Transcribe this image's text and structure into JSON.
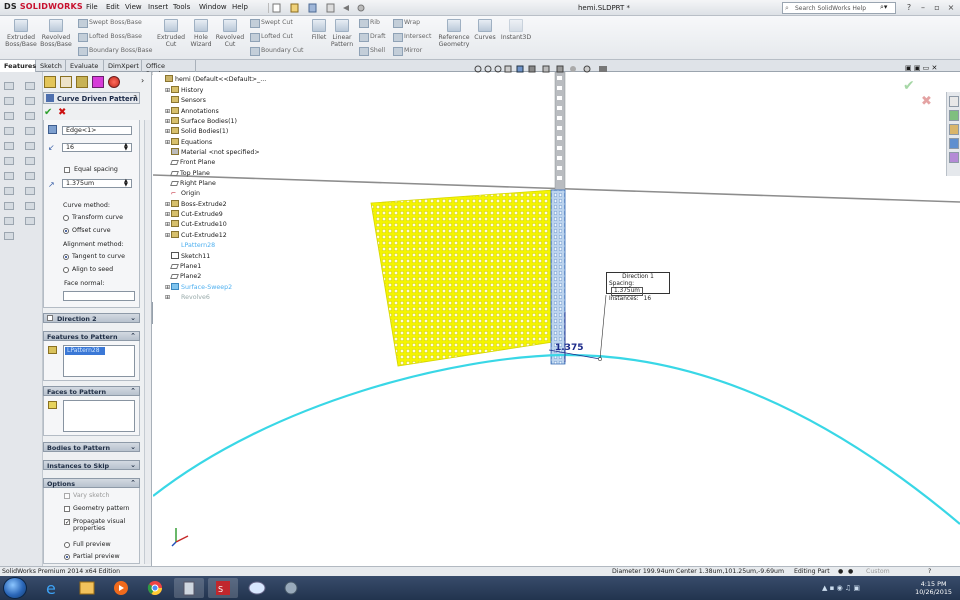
{
  "app": {
    "logo_brand": "SOLIDWORKS",
    "logo_prefix": "DS",
    "document_title": "hemi.SLDPRT *",
    "search_placeholder": "Search SolidWorks Help"
  },
  "menu": [
    "File",
    "Edit",
    "View",
    "Insert",
    "Tools",
    "Window",
    "Help"
  ],
  "toolbar": {
    "extruded_boss": "Extruded\nBoss/Base",
    "revolved_boss": "Revolved\nBoss/Base",
    "swept_boss": "Swept Boss/Base",
    "lofted_boss": "Lofted Boss/Base",
    "boundary_boss": "Boundary Boss/Base",
    "extruded_cut": "Extruded\nCut",
    "hole_wizard": "Hole\nWizard",
    "revolved_cut": "Revolved\nCut",
    "swept_cut": "Swept Cut",
    "lofted_cut": "Lofted Cut",
    "boundary_cut": "Boundary Cut",
    "fillet": "Fillet",
    "linear_pattern": "Linear\nPattern",
    "rib": "Rib",
    "draft": "Draft",
    "shell": "Shell",
    "wrap": "Wrap",
    "intersect": "Intersect",
    "mirror": "Mirror",
    "reference_geometry": "Reference\nGeometry",
    "curves": "Curves",
    "instant3d": "Instant3D"
  },
  "tabs": [
    "Features",
    "Sketch",
    "Evaluate",
    "DimXpert",
    "Office Products"
  ],
  "property_manager": {
    "title": "Curve Driven Pattern",
    "direction1": {
      "edge": "Edge<1>",
      "instances": "16",
      "equal_spacing": "Equal spacing",
      "spacing": "1.375um",
      "curve_method_label": "Curve method:",
      "transform_curve": "Transform curve",
      "offset_curve": "Offset curve",
      "alignment_label": "Alignment method:",
      "tangent_to_curve": "Tangent to curve",
      "align_to_seed": "Align to seed",
      "face_normal": "Face normal:"
    },
    "direction2": "Direction 2",
    "features_to_pattern": "Features to Pattern",
    "features_item": "LPattern28",
    "faces_to_pattern": "Faces to Pattern",
    "bodies_to_pattern": "Bodies to Pattern",
    "instances_to_skip": "Instances to Skip",
    "options": {
      "title": "Options",
      "vary_sketch": "Vary sketch",
      "geometry_pattern": "Geometry pattern",
      "propagate": "Propagate visual\nproperties",
      "full_preview": "Full preview",
      "partial_preview": "Partial preview"
    }
  },
  "feature_tree": {
    "root": "hemi  (Default<<Default>_...",
    "items": [
      "History",
      "Sensors",
      "Annotations",
      "Surface Bodies(1)",
      "Solid Bodies(1)",
      "Equations",
      "Material <not specified>",
      "Front Plane",
      "Top Plane",
      "Right Plane",
      "Origin",
      "Boss-Extrude2",
      "Cut-Extrude9",
      "Cut-Extrude10",
      "Cut-Extrude12",
      "LPattern28",
      "Sketch11",
      "Plane1",
      "Plane2",
      "Surface-Sweep2",
      "Revolve6"
    ]
  },
  "callout": {
    "title": "Direction 1",
    "spacing_label": "Spacing:",
    "spacing_value": "1.375um",
    "instances_label": "Instances:",
    "instances_value": "16"
  },
  "dimension_text": "1.375",
  "statusbar": {
    "edition": "SolidWorks Premium 2014 x64 Edition",
    "diameter": "Diameter 199.94um",
    "center": "Center 1.38um,101.25um,-9.69um",
    "mode": "Editing Part",
    "custom": "Custom"
  },
  "taskbar": {
    "time": "4:15 PM",
    "date": "10/26/2015"
  },
  "colors": {
    "preview_yellow": "#f4f400",
    "curve_cyan": "#39d7e6",
    "selection_blue": "#3b78d6",
    "accent_red": "#c8102e"
  }
}
